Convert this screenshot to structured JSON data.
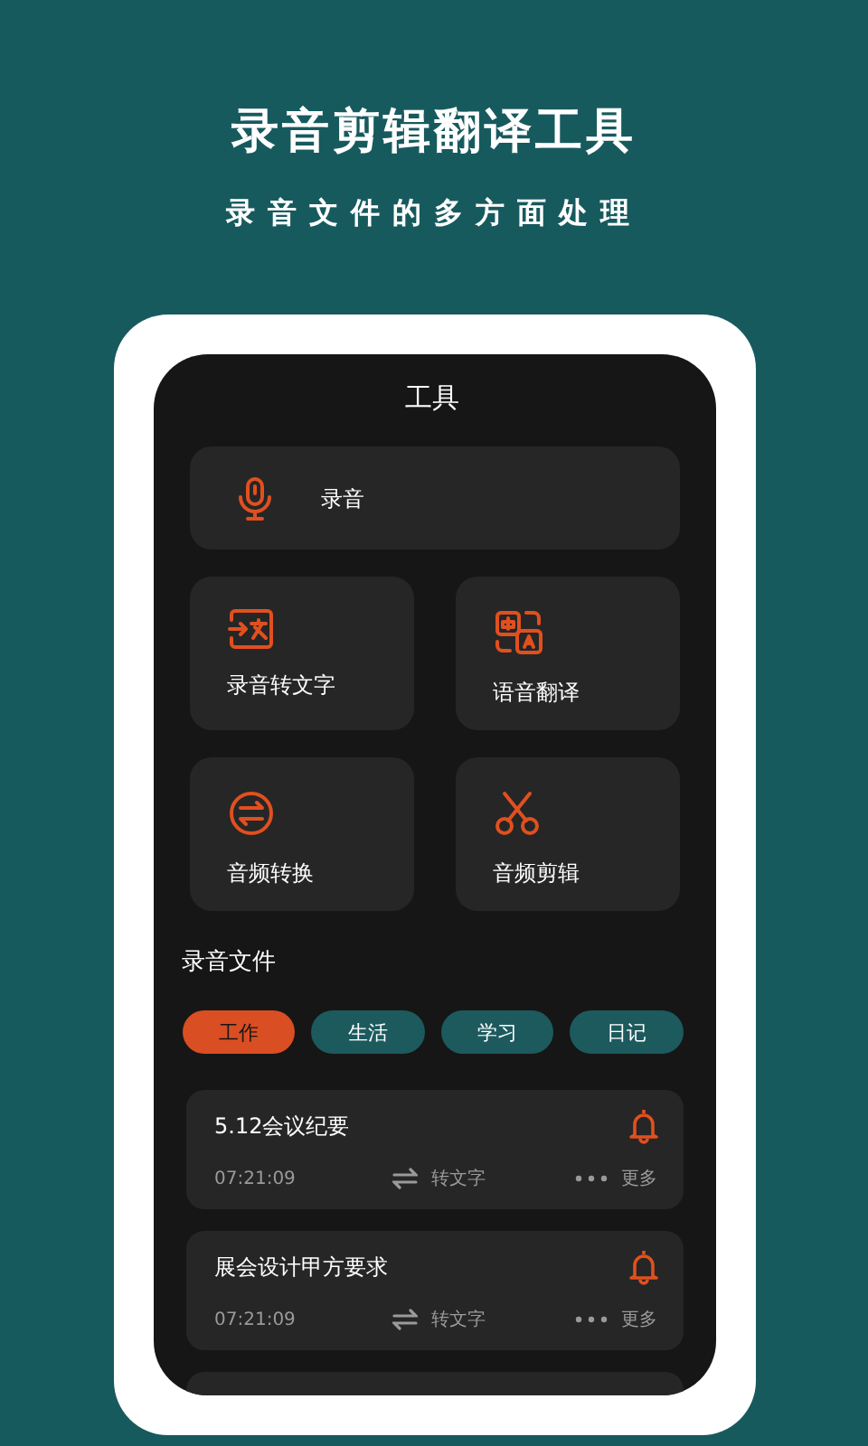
{
  "headline": "录音剪辑翻译工具",
  "subheadline": "录音文件的多方面处理",
  "screen": {
    "title": "工具",
    "tools": [
      {
        "kind": "wide",
        "label": "录音"
      },
      {
        "kind": "tile",
        "label": "录音转文字"
      },
      {
        "kind": "tile",
        "label": "语音翻译"
      },
      {
        "kind": "tile",
        "label": "音频转换"
      },
      {
        "kind": "tile",
        "label": "音频剪辑"
      }
    ],
    "section_title": "录音文件",
    "tabs": [
      {
        "label": "工作",
        "selected": true
      },
      {
        "label": "生活",
        "selected": false
      },
      {
        "label": "学习",
        "selected": false
      },
      {
        "label": "日记",
        "selected": false
      }
    ],
    "records": [
      {
        "title": "5.12会议纪要",
        "time": "07:21:09",
        "convert": "转文字",
        "more": "更多"
      },
      {
        "title": "展会设计甲方要求",
        "time": "07:21:09",
        "convert": "转文字",
        "more": "更多"
      }
    ]
  }
}
